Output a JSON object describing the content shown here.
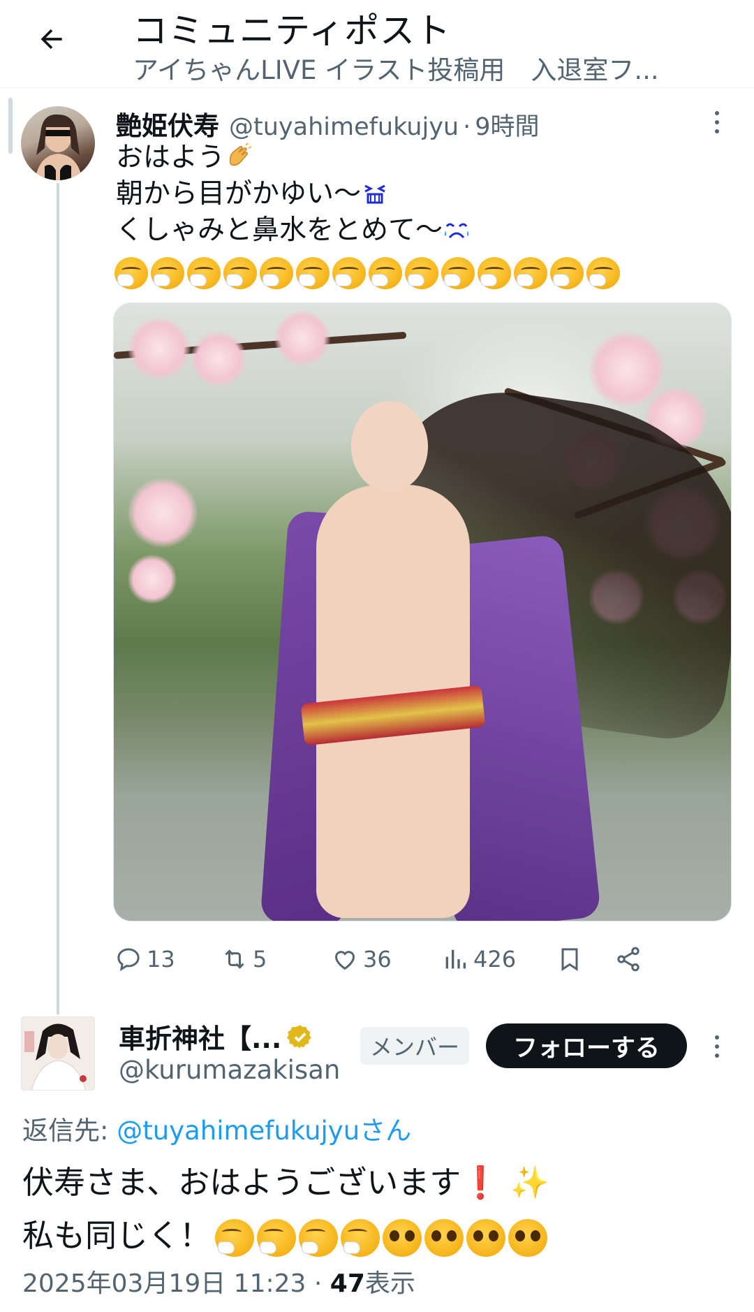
{
  "header": {
    "title": "コミュニティポスト",
    "subtitle": "アイちゃんLIVE イラスト投稿用　入退室フ..."
  },
  "post": {
    "name": "艶姫伏寿",
    "handle": "@tuyahimefukujyu",
    "separator": "·",
    "time": "9時間",
    "lines": [
      "おはよう",
      "朝から目がかゆい〜",
      "くしゃみと鼻水をとめて〜"
    ],
    "line_emojis": [
      "waving-hands",
      "tired-face",
      "sweat-face"
    ],
    "sneeze_emoji_count": 14,
    "image_alt_icon": "post-image",
    "stats": {
      "replies": "13",
      "reposts": "5",
      "likes": "36",
      "views": "426"
    }
  },
  "reply": {
    "name": "車折神社【...",
    "handle": "@kurumazakisan",
    "member_badge": "メンバー",
    "follow_label": "フォローする",
    "reply_prefix": "返信先: ",
    "reply_mention": "@tuyahimefukujyuさん",
    "line1": "伏寿さま、おはようございます",
    "line1_exclaim": "❗",
    "line1_sparkle": "✨",
    "line2": "私も同じく！",
    "line2_emojis": [
      "sneeze",
      "sneeze",
      "sneeze",
      "sneeze",
      "pleading",
      "pleading",
      "pleading",
      "pleading"
    ],
    "date": "2025年03月19日 11:23",
    "dot": "·",
    "views_count": "47",
    "views_label": "表示"
  },
  "colors": {
    "text": "#0f1419",
    "secondary": "#536471",
    "link": "#1d9bf0",
    "border": "#eff3f4",
    "verified": "#e2b719"
  }
}
